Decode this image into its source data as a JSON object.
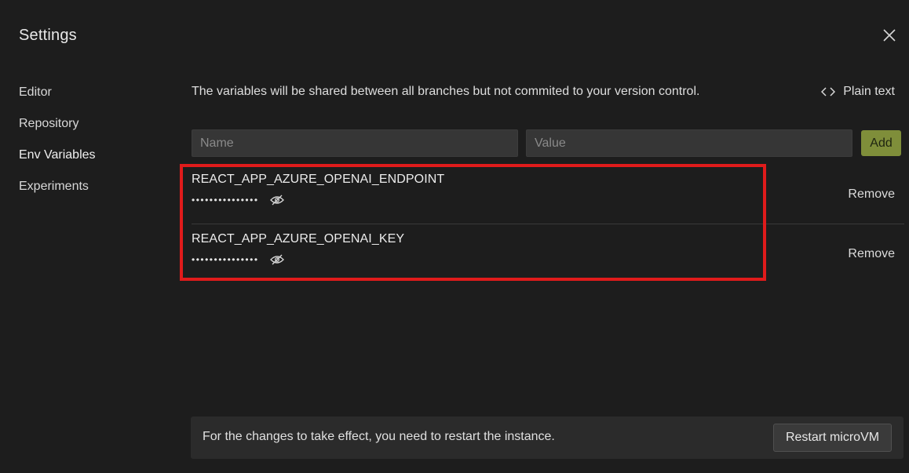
{
  "header": {
    "title": "Settings"
  },
  "sidebar": {
    "items": [
      {
        "label": "Editor"
      },
      {
        "label": "Repository"
      },
      {
        "label": "Env Variables"
      },
      {
        "label": "Experiments"
      }
    ],
    "active": "Env Variables"
  },
  "env": {
    "description": "The variables will be shared between all branches but not commited to your version control.",
    "plain_text_label": "Plain text",
    "name_placeholder": "Name",
    "value_placeholder": "Value",
    "add_label": "Add",
    "variables": [
      {
        "name": "REACT_APP_AZURE_OPENAI_ENDPOINT",
        "masked_value": "•••••••••••••••",
        "remove_label": "Remove"
      },
      {
        "name": "REACT_APP_AZURE_OPENAI_KEY",
        "masked_value": "•••••••••••••••",
        "remove_label": "Remove"
      }
    ]
  },
  "footer": {
    "message": "For the changes to take effect, you need to restart the instance.",
    "restart_label": "Restart microVM"
  },
  "colors": {
    "background": "#1d1d1d",
    "accent_add": "#7f8e3a",
    "highlight": "#e01b1b"
  },
  "icons": {
    "close": "close-icon",
    "plain_text": "code-brackets-icon",
    "hidden": "eye-off-icon"
  }
}
